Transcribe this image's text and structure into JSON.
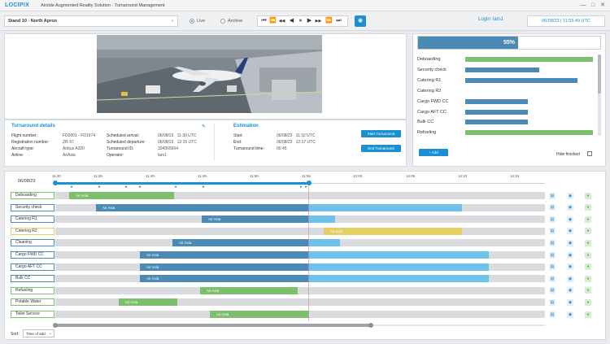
{
  "app": {
    "logo": "LOCIPIX",
    "title": "Airside Augmented Reality Solution - Turnaround Management",
    "window_buttons": [
      "—",
      "□",
      "✕"
    ]
  },
  "toolbar": {
    "stand": "Stand 10 - North Apron",
    "live_label": "Live",
    "archive_label": "Archive",
    "mode": "Live",
    "media_buttons": [
      "⏮",
      "⏪",
      "◀◀",
      "◀",
      "⏸",
      "▶",
      "▶▶",
      "⏩",
      "⏭"
    ],
    "login": "Login: lars1",
    "datetime": "06/08/23 | 11:55:49 UTC"
  },
  "details": {
    "title": "Turnaround details",
    "left": [
      {
        "label": "Flight number:",
        "value": "FD0001 - FD1974"
      },
      {
        "label": "Registration number:",
        "value": "ZR-57"
      },
      {
        "label": "Aircraft type:",
        "value": "Airbus A320"
      },
      {
        "label": "Airline:",
        "value": "AirAsia"
      }
    ],
    "right": [
      {
        "label": "Scheduled arrival:",
        "value": "06/08/23   11:30 UTC"
      },
      {
        "label": "Scheduled departure:",
        "value": "06/08/23   12:15 UTC"
      },
      {
        "label": "Turnaround ID:",
        "value": "334565664"
      },
      {
        "label": "Operator:",
        "value": "lars1"
      }
    ]
  },
  "estimation": {
    "title": "Estimation",
    "rows": [
      {
        "label": "Start:",
        "value": "06/08/23   11:32 UTC"
      },
      {
        "label": "End:",
        "value": "06/08/23   12:17 UTC"
      },
      {
        "label": "Turnaround time:",
        "value": "00:45"
      }
    ],
    "start_button": "Start Turnaround",
    "end_button": "End Turnaround"
  },
  "progress": {
    "percent_label": "55%",
    "fraction": 0.55
  },
  "process_list": [
    {
      "label": "Deboarding",
      "fraction": 1.0,
      "color": "#7dbf6c"
    },
    {
      "label": "Security check",
      "fraction": 0.58,
      "color": "#4a8ab4"
    },
    {
      "label": "Catering R1",
      "fraction": 0.88,
      "color": "#4a8ab4"
    },
    {
      "label": "Catering R2",
      "fraction": 0,
      "color": "#4a8ab4"
    },
    {
      "label": "Cargo FWD CC",
      "fraction": 0.49,
      "color": "#4a8ab4"
    },
    {
      "label": "Cargo AFT CC",
      "fraction": 0.49,
      "color": "#4a8ab4"
    },
    {
      "label": "Bulk CC",
      "fraction": 0.49,
      "color": "#4a8ab4"
    },
    {
      "label": "Refueling",
      "fraction": 1.0,
      "color": "#7dbf6c"
    }
  ],
  "right_controls": {
    "add_button": "+ Add",
    "hide_finished": "Hide finished"
  },
  "timeline": {
    "date": "06/08/23",
    "ticks": [
      "11:30",
      "11:35",
      "11:40",
      "11:45",
      "11:50",
      "11:55",
      "12:00",
      "12:05",
      "12:10",
      "12:15"
    ],
    "now_tick": "11:55"
  },
  "gantt_rows": [
    {
      "label": "Deboarding",
      "border": "#7dbf6c",
      "segments": [
        {
          "start": 85,
          "end": 214,
          "color": "#7dbf6c",
          "text": "Air Asia"
        }
      ]
    },
    {
      "label": "Security check",
      "border": "#4a8ab4",
      "segments": [
        {
          "start": 118,
          "end": 380,
          "color": "#4a8ab4",
          "text": "Air Asia"
        },
        {
          "start": 380,
          "end": 568,
          "color": "#6ec1ea",
          "text": ""
        }
      ]
    },
    {
      "label": "Catering R1",
      "border": "#4a8ab4",
      "segments": [
        {
          "start": 248,
          "end": 380,
          "color": "#4a8ab4",
          "text": "Air Asia"
        },
        {
          "start": 380,
          "end": 412,
          "color": "#6ec1ea",
          "text": ""
        }
      ]
    },
    {
      "label": "Catering R2",
      "border": "#e3cf63",
      "segments": [
        {
          "start": 398,
          "end": 568,
          "color": "#e3cf63",
          "text": "Air Asia"
        }
      ]
    },
    {
      "label": "Cleaning",
      "border": "#4a8ab4",
      "segments": [
        {
          "start": 212,
          "end": 380,
          "color": "#4a8ab4",
          "text": "Air Asia"
        },
        {
          "start": 380,
          "end": 418,
          "color": "#6ec1ea",
          "text": ""
        }
      ]
    },
    {
      "label": "Cargo FWD CC",
      "border": "#4a8ab4",
      "segments": [
        {
          "start": 172,
          "end": 380,
          "color": "#4a8ab4",
          "text": "Air Asia"
        },
        {
          "start": 380,
          "end": 601,
          "color": "#6ec1ea",
          "text": ""
        }
      ]
    },
    {
      "label": "Cargo AFT CC",
      "border": "#4a8ab4",
      "segments": [
        {
          "start": 172,
          "end": 380,
          "color": "#4a8ab4",
          "text": "Air Asia"
        },
        {
          "start": 380,
          "end": 601,
          "color": "#6ec1ea",
          "text": ""
        }
      ]
    },
    {
      "label": "Bulk CC",
      "border": "#4a8ab4",
      "segments": [
        {
          "start": 172,
          "end": 380,
          "color": "#4a8ab4",
          "text": "Air Asia"
        },
        {
          "start": 380,
          "end": 601,
          "color": "#6ec1ea",
          "text": ""
        }
      ]
    },
    {
      "label": "Refueling",
      "border": "#7dbf6c",
      "segments": [
        {
          "start": 246,
          "end": 366,
          "color": "#7dbf6c",
          "text": "Air Asia"
        }
      ]
    },
    {
      "label": "Potable Water",
      "border": "#7dbf6c",
      "segments": [
        {
          "start": 146,
          "end": 218,
          "color": "#7dbf6c",
          "text": "Air Asia"
        }
      ]
    },
    {
      "label": "Toilet Service",
      "border": "#7dbf6c",
      "segments": [
        {
          "start": 258,
          "end": 380,
          "color": "#7dbf6c",
          "text": "Air Asia"
        }
      ]
    }
  ],
  "sort": {
    "label": "Sort:",
    "value": "Time of add"
  }
}
